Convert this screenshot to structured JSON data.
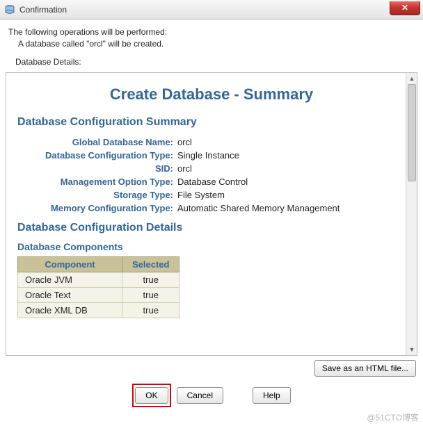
{
  "window": {
    "title": "Confirmation"
  },
  "intro": {
    "line1": "The following operations will be performed:",
    "line2": "A database called \"orcl\" will be created.",
    "details_label": "Database Details:"
  },
  "summary": {
    "title": "Create Database - Summary",
    "section1": "Database Configuration Summary",
    "rows": [
      {
        "label": "Global Database Name:",
        "value": "orcl"
      },
      {
        "label": "Database Configuration Type:",
        "value": "Single Instance"
      },
      {
        "label": "SID:",
        "value": "orcl"
      },
      {
        "label": "Management Option Type:",
        "value": "Database Control"
      },
      {
        "label": "Storage Type:",
        "value": "File System"
      },
      {
        "label": "Memory Configuration Type:",
        "value": "Automatic Shared Memory Management"
      }
    ],
    "section2": "Database Configuration Details",
    "subsection": "Database Components",
    "table": {
      "headers": [
        "Component",
        "Selected"
      ],
      "rows": [
        {
          "component": "Oracle JVM",
          "selected": "true"
        },
        {
          "component": "Oracle Text",
          "selected": "true"
        },
        {
          "component": "Oracle XML DB",
          "selected": "true"
        }
      ]
    }
  },
  "buttons": {
    "save": "Save as an HTML file...",
    "ok": "OK",
    "cancel": "Cancel",
    "help": "Help"
  },
  "watermark": "@51CTO博客"
}
